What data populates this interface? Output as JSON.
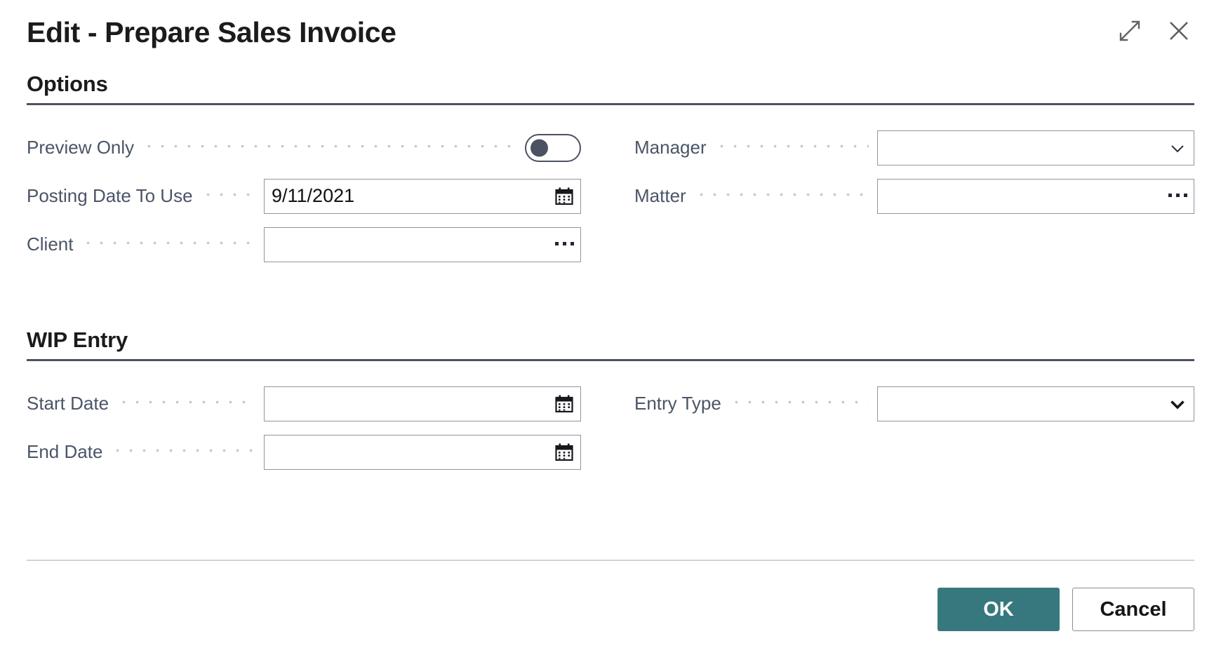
{
  "window": {
    "title": "Edit - Prepare Sales Invoice",
    "expand_icon": "expand-diagonal-icon",
    "close_icon": "close-icon"
  },
  "sections": [
    {
      "id": "options",
      "title": "Options",
      "left_fields": [
        {
          "label": "Preview Only",
          "type": "toggle",
          "value": "",
          "checked": false
        },
        {
          "label": "Posting Date To Use",
          "type": "date",
          "value": "9/11/2021",
          "affordance": "calendar-icon"
        },
        {
          "label": "Client",
          "type": "lookup",
          "value": "",
          "affordance": "ellipsis-icon"
        }
      ],
      "right_fields": [
        {
          "label": "Manager",
          "type": "dropdown",
          "value": "",
          "affordance": "chevron-down-icon"
        },
        {
          "label": "Matter",
          "type": "lookup",
          "value": "",
          "affordance": "ellipsis-icon"
        }
      ]
    },
    {
      "id": "wip-entry",
      "title": "WIP Entry",
      "left_fields": [
        {
          "label": "Start Date",
          "type": "date",
          "value": "",
          "affordance": "calendar-icon"
        },
        {
          "label": "End Date",
          "type": "date",
          "value": "",
          "affordance": "calendar-icon"
        }
      ],
      "right_fields": [
        {
          "label": "Entry Type",
          "type": "select",
          "value": "",
          "affordance": "chevron-down-bold-icon"
        }
      ]
    }
  ],
  "footer": {
    "ok_label": "OK",
    "cancel_label": "Cancel"
  },
  "colors": {
    "primary_button": "#37787e",
    "section_rule": "#4d5260",
    "label_text": "#4b5567",
    "field_border": "#9094a3"
  }
}
